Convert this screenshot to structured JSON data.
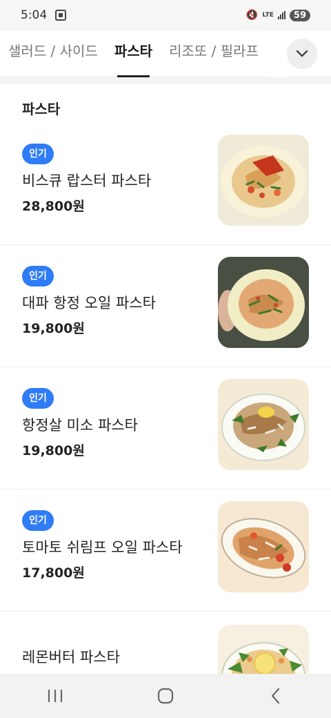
{
  "status_bar": {
    "time": "5:04",
    "network": "LTE",
    "battery": "59"
  },
  "tabs": [
    {
      "label": "샐러드 / 사이드",
      "active": false
    },
    {
      "label": "파스타",
      "active": true
    },
    {
      "label": "리조또 / 필라프",
      "active": false
    }
  ],
  "section": {
    "title": "파스타"
  },
  "menu_items": [
    {
      "badge": "인기",
      "name": "비스큐 랍스터 파스타",
      "price": "28,800원"
    },
    {
      "badge": "인기",
      "name": "대파 항정 오일 파스타",
      "price": "19,800원"
    },
    {
      "badge": "인기",
      "name": "항정살 미소 파스타",
      "price": "19,800원"
    },
    {
      "badge": "인기",
      "name": "토마토 쉬림프 오일 파스타",
      "price": "17,800원"
    },
    {
      "badge": "",
      "name": "레몬버터 파스타",
      "price": ""
    }
  ],
  "icons": {
    "more_tabs": "chevron-down-icon",
    "nav_recent": "recent-apps-icon",
    "nav_home": "home-icon",
    "nav_back": "back-icon"
  },
  "colors": {
    "badge": "#2f7cf6",
    "status_bar": "#f6f6f6",
    "nav_bar": "#f2f2f2"
  }
}
